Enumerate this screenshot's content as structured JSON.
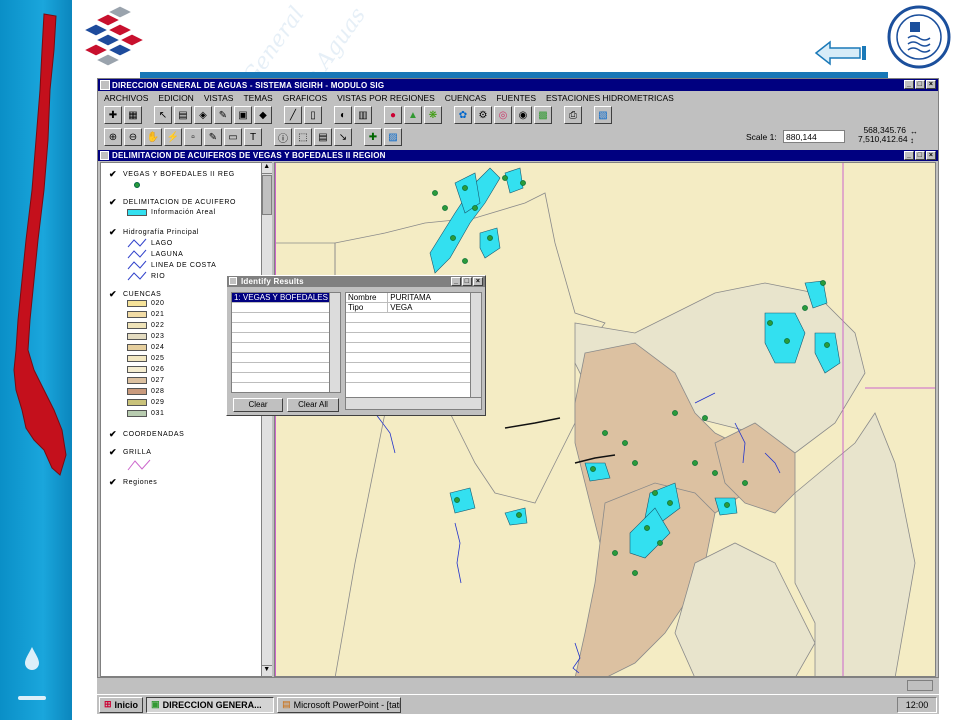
{
  "app": {
    "title": "DIRECCION GENERAL DE AGUAS - SISTEMA SIGIRH - MODULO SIG",
    "menu": [
      "ARCHIVOS",
      "EDICION",
      "VISTAS",
      "TEMAS",
      "GRAFICOS",
      "VISTAS POR REGIONES",
      "CUENCAS",
      "FUENTES",
      "ESTACIONES HIDROMETRICAS"
    ],
    "scale_label": "Scale 1:",
    "scale_value": "880,144",
    "coord_x": "568,345.76",
    "coord_y": "7,510,412.64"
  },
  "view": {
    "title": "DELIMITACION DE ACUIFEROS DE VEGAS Y BOFEDALES II REGION"
  },
  "legend": {
    "layer_vegas": "VEGAS Y BOFEDALES II REG",
    "layer_delim": "DELIMITACION DE ACUIFERO",
    "delim_item": "Información Areal",
    "layer_hidro": "Hidrografía Principal",
    "hidro_items": [
      "LAGO",
      "LAGUNA",
      "LINEA DE COSTA",
      "RIO"
    ],
    "layer_cuencas": "CUENCAS",
    "cuencas": [
      {
        "code": "020",
        "color": "#f6e39a"
      },
      {
        "code": "021",
        "color": "#f2dca5"
      },
      {
        "code": "022",
        "color": "#efe3b8"
      },
      {
        "code": "023",
        "color": "#e4dcc1"
      },
      {
        "code": "024",
        "color": "#e6cf9e"
      },
      {
        "code": "025",
        "color": "#f3e8c2"
      },
      {
        "code": "026",
        "color": "#f5edd0"
      },
      {
        "code": "027",
        "color": "#dcc1a1"
      },
      {
        "code": "028",
        "color": "#c99a7d"
      },
      {
        "code": "029",
        "color": "#c9c27a"
      },
      {
        "code": "031",
        "color": "#b8ccb0"
      }
    ],
    "layer_coord": "COORDENADAS",
    "layer_grilla": "GRILLA",
    "layer_regiones": "Regiones"
  },
  "identify": {
    "title": "Identify Results",
    "result": "1:  VEGAS Y BOFEDALES",
    "fields": [
      {
        "name": "Nombre",
        "value": "PURITAMA"
      },
      {
        "name": "Tipo",
        "value": "VEGA"
      }
    ],
    "clear": "Clear",
    "clear_all": "Clear All"
  },
  "taskbar": {
    "start": "Inicio",
    "tasks": [
      "DIRECCION GENERA...",
      "Microsoft PowerPoint - [tati..."
    ],
    "clock": "12:00"
  },
  "colors": {
    "titlebar": "#000080",
    "water": "#33e0f0",
    "vega_dot": "#2a9a3a",
    "map_bg": "#f4ecc4",
    "cuenca_brown": "#dcc1a1",
    "cuenca_grey": "#e8e4cc",
    "grid_line": "#cc66cc"
  }
}
